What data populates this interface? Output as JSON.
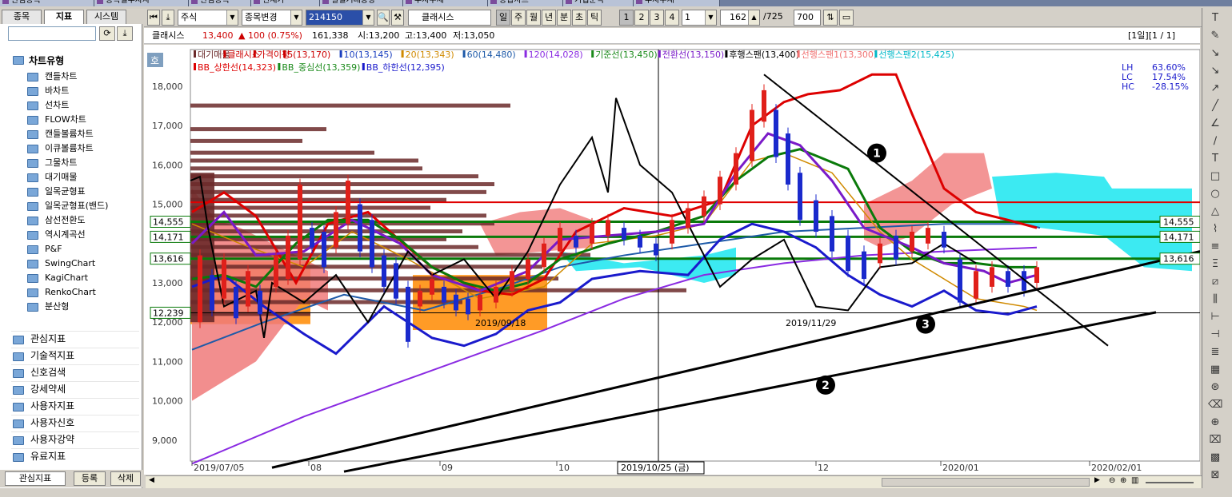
{
  "window_tabs": [
    "관심종목",
    "종목별투자자",
    "관심종목",
    "현재가",
    "일별거래동향",
    "투자주체",
    "종합차트",
    "기업분석",
    "투자주체"
  ],
  "left_panel": {
    "tabs": [
      "종목",
      "지표",
      "시스템"
    ],
    "tree_title": "차트유형",
    "chart_types": [
      "캔들차트",
      "바차트",
      "선차트",
      "FLOW차트",
      "캔들볼륨차트",
      "이큐볼륨차트",
      "그물차트",
      "대기매물",
      "일목균형표",
      "일목균형표(밴드)",
      "삼선전환도",
      "역시계곡선",
      "P&F",
      "SwingChart",
      "KagiChart",
      "RenkoChart",
      "분산형"
    ],
    "categories": [
      "관심지표",
      "기술적지표",
      "신호검색",
      "강세약세",
      "사용자지표",
      "사용자신호",
      "사용자강약",
      "유료지표"
    ],
    "bottom_buttons": [
      "관심지표",
      "등록",
      "삭제"
    ]
  },
  "toolbar": {
    "market": "주식",
    "mode": "종목변경",
    "code": "214150",
    "stock_name": "클래시스",
    "periods": [
      "일",
      "주",
      "월",
      "년",
      "분",
      "초",
      "틱"
    ],
    "numbers": [
      "1",
      "2",
      "3",
      "4"
    ],
    "interval": "1",
    "count": "162",
    "total": "/725",
    "zoom": "700"
  },
  "infobar": {
    "name": "클래시스",
    "price": "13,400",
    "change": "▲ 100 (0.75%)",
    "volume": "161,338",
    "open": "시:13,200",
    "high": "고:13,400",
    "low": "저:13,050",
    "period_label": "[1일][1 / 1]"
  },
  "legend": {
    "row1": [
      {
        "text": "대기매물",
        "color": "#6b2a2a"
      },
      {
        "text": "클래시스",
        "color": "#cc0000"
      },
      {
        "text": "가격이평",
        "color": "#cc0000"
      },
      {
        "text": "5(13,170)",
        "color": "#cc0000"
      },
      {
        "text": "10(13,145)",
        "color": "#1a3fbf"
      },
      {
        "text": "20(13,343)",
        "color": "#d08a00"
      },
      {
        "text": "60(14,480)",
        "color": "#1e5aa8"
      },
      {
        "text": "120(14,028)",
        "color": "#8a2be2"
      },
      {
        "text": "기준선(13,450)",
        "color": "#1a8a1a"
      },
      {
        "text": "전환선(13,150)",
        "color": "#7a1ac8"
      },
      {
        "text": "후행스팬(13,400)",
        "color": "#000000"
      },
      {
        "text": "선행스팬1(13,300)",
        "color": "#f07070"
      },
      {
        "text": "선행스팬2(15,425)",
        "color": "#00b8c8"
      }
    ],
    "row2": [
      {
        "text": "BB_상한선(14,323)",
        "color": "#dd0000"
      },
      {
        "text": "BB_중심선(13,359)",
        "color": "#1a8a1a"
      },
      {
        "text": "BB_하한선(12,395)",
        "color": "#1a1acc"
      }
    ],
    "stats": [
      {
        "k": "LH",
        "v": "63.60%"
      },
      {
        "k": "LC",
        "v": "17.54%"
      },
      {
        "k": "HC",
        "v": "-28.15%"
      }
    ]
  },
  "chart_data": {
    "type": "candlestick",
    "yticks": [
      "18,000",
      "17,000",
      "16,000",
      "15,000",
      "13,000",
      "12,000",
      "11,000",
      "10,000",
      "9,000"
    ],
    "xticks": [
      "2019/07/05",
      "08",
      "09",
      "10",
      "12",
      "2020/01",
      "2020/02/01"
    ],
    "crosshair_date": "2019/10/25 (금)",
    "left_value_boxes": [
      "14,555",
      "14,171",
      "13,616",
      "12,239"
    ],
    "right_value_boxes": [
      "14,555",
      "14,171",
      "13,616"
    ],
    "date_annotations": [
      "2019/09/18",
      "2019/11/29"
    ],
    "circle_markers": [
      "1",
      "2",
      "3"
    ],
    "corner_label": "호"
  },
  "colors": {
    "bg": "#ffffff",
    "up": "#e0201a",
    "down": "#1a2acc",
    "cloud_pink": "#f07a7a",
    "cloud_cyan": "#1ae6f0",
    "orange_box": "#ff8a00"
  }
}
